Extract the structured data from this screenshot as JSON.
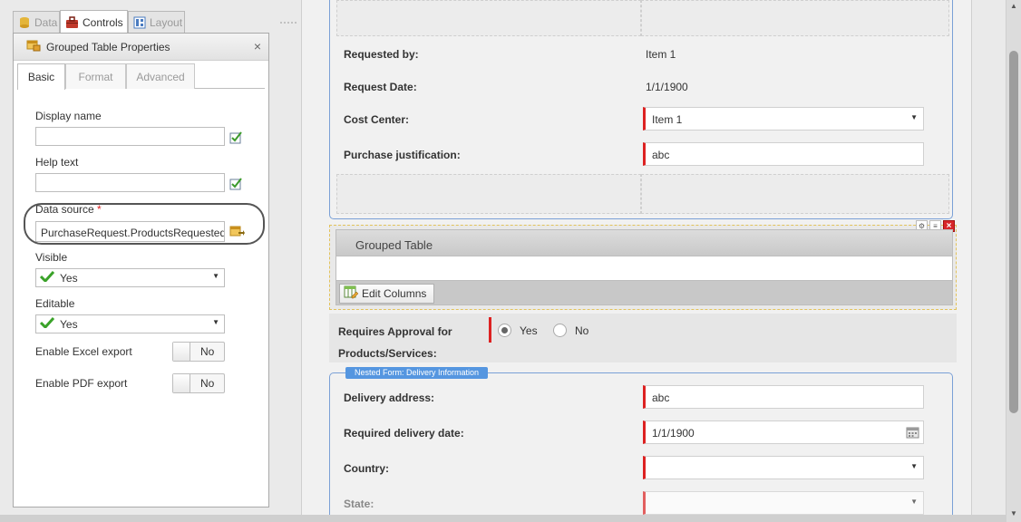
{
  "left_tabs": [
    {
      "label": "Data",
      "active": false
    },
    {
      "label": "Controls",
      "active": true
    },
    {
      "label": "Layout",
      "active": false
    }
  ],
  "panel": {
    "title": "Grouped Table Properties",
    "close_icon": "×",
    "tabs": [
      {
        "label": "Basic",
        "active": true
      },
      {
        "label": "Format",
        "active": false
      },
      {
        "label": "Advanced",
        "active": false
      }
    ],
    "fields": {
      "display_name": {
        "label": "Display name",
        "value": ""
      },
      "help_text": {
        "label": "Help text",
        "value": ""
      },
      "data_source": {
        "label": "Data source",
        "required_mark": "*",
        "value": "PurchaseRequest.ProductsRequested"
      },
      "visible": {
        "label": "Visible",
        "value": "Yes"
      },
      "editable": {
        "label": "Editable",
        "value": "Yes"
      },
      "excel_export": {
        "label": "Enable Excel export",
        "value": "No"
      },
      "pdf_export": {
        "label": "Enable PDF export",
        "value": "No"
      }
    }
  },
  "form": {
    "rows": [
      {
        "label": "Requested by:",
        "value": "Item 1",
        "type": "text"
      },
      {
        "label": "Request Date:",
        "value": "1/1/1900",
        "type": "text"
      },
      {
        "label": "Cost Center:",
        "value": "Item 1",
        "type": "dropdown"
      },
      {
        "label": "Purchase justification:",
        "value": "abc",
        "type": "input"
      }
    ],
    "grouped_table": {
      "title": "Grouped Table",
      "edit_columns": "Edit Columns"
    },
    "approval": {
      "label": "Requires Approval for Products/Services:",
      "options": [
        "Yes",
        "No"
      ],
      "selected": "Yes"
    },
    "nested_form": {
      "badge": "Nested Form: Delivery Information",
      "rows": [
        {
          "label": "Delivery address:",
          "value": "abc",
          "type": "input"
        },
        {
          "label": "Required delivery date:",
          "value": "1/1/1900",
          "type": "date"
        },
        {
          "label": "Country:",
          "value": "",
          "type": "dropdown"
        },
        {
          "label": "State:",
          "value": "",
          "type": "dropdown"
        }
      ]
    }
  },
  "colors": {
    "accent_blue": "#7aa0d6",
    "required_red": "#d22222",
    "check_green": "#3aa229"
  },
  "icons": [
    "data-icon",
    "controls-icon",
    "layout-icon",
    "table-properties-icon",
    "close-icon",
    "expression-icon",
    "data-source-icon",
    "check-icon",
    "chevron-down-icon",
    "calendar-icon",
    "edit-columns-icon",
    "gear-icon",
    "list-icon",
    "delete-icon"
  ]
}
